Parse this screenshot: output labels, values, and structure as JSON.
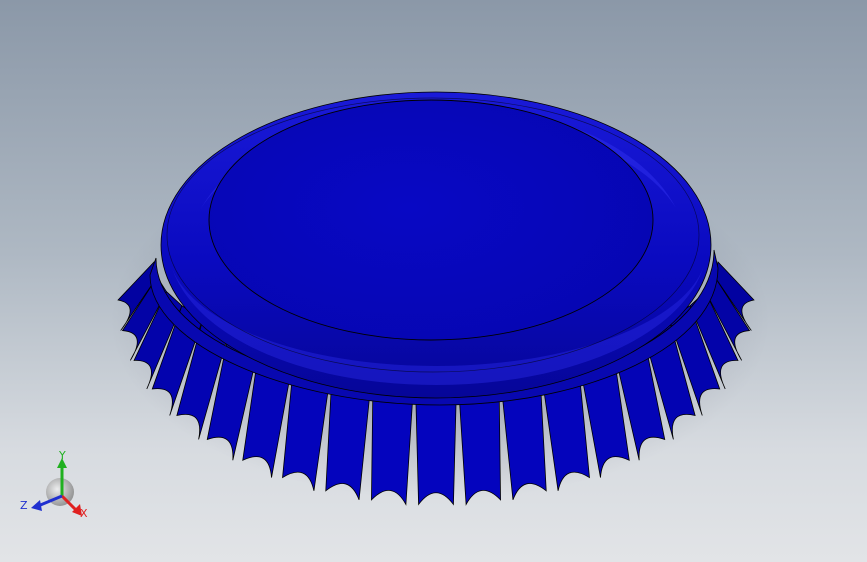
{
  "viewport": {
    "background_top": "#8b98a8",
    "background_bottom": "#e2e4e7"
  },
  "model": {
    "part": "bottle-cap",
    "face_color": "#0a0ac8",
    "dark_color": "#000080",
    "edge_color": "#000000"
  },
  "triad": {
    "x_label": "X",
    "y_label": "Y",
    "z_label": "Z",
    "x_color": "#e02020",
    "y_color": "#20b020",
    "z_color": "#2030d0"
  }
}
